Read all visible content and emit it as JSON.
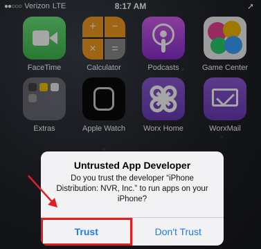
{
  "status_bar": {
    "signal": "●●○○○",
    "carrier": "Verizon",
    "network": "LTE",
    "time": "8:17 AM",
    "location_arrow": "➚"
  },
  "apps": [
    {
      "label": "FaceTime",
      "icon": "facetime-icon"
    },
    {
      "label": "Calculator",
      "icon": "calculator-icon"
    },
    {
      "label": "Podcasts",
      "icon": "podcasts-icon"
    },
    {
      "label": "Game Center",
      "icon": "game-center-icon"
    },
    {
      "label": "Extras",
      "icon": "folder-icon"
    },
    {
      "label": "Apple Watch",
      "icon": "apple-watch-icon"
    },
    {
      "label": "Worx Home",
      "icon": "worx-home-icon"
    },
    {
      "label": "WorxMail",
      "icon": "worxmail-icon"
    }
  ],
  "calculator_keys": [
    "+",
    "−",
    "×",
    "="
  ],
  "alert": {
    "title": "Untrusted App Developer",
    "message": "Do you trust the developer “iPhone Distribution: NVR, Inc.” to run apps on your iPhone?",
    "trust_label": "Trust",
    "dont_trust_label": "Don't Trust"
  },
  "colors": {
    "accent": "#1a7af0",
    "highlight": "#e02020"
  }
}
